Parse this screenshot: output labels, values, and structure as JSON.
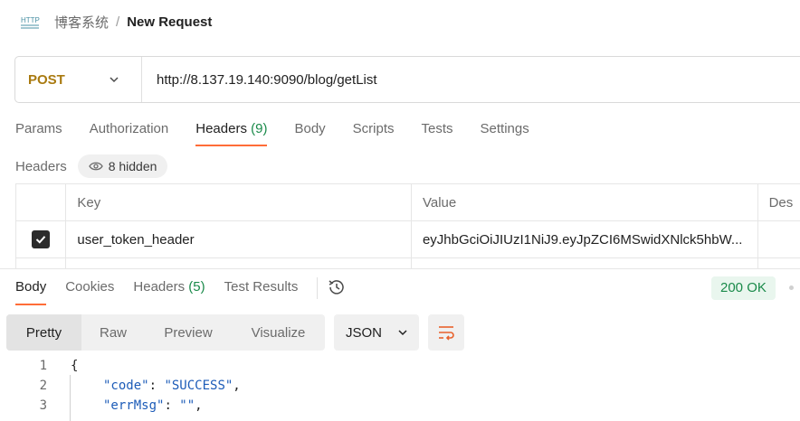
{
  "breadcrumb": {
    "parent": "博客系统",
    "separator": "/",
    "current": "New Request"
  },
  "request": {
    "method": "POST",
    "url": "http://8.137.19.140:9090/blog/getList"
  },
  "request_tabs": [
    {
      "label": "Params"
    },
    {
      "label": "Authorization"
    },
    {
      "label": "Headers",
      "count": "(9)",
      "active": true
    },
    {
      "label": "Body"
    },
    {
      "label": "Scripts"
    },
    {
      "label": "Tests"
    },
    {
      "label": "Settings"
    }
  ],
  "headers_section": {
    "title": "Headers",
    "hidden_label": "8 hidden"
  },
  "headers_table": {
    "columns": [
      "Key",
      "Value",
      "Des"
    ],
    "rows": [
      {
        "checked": true,
        "key": "user_token_header",
        "value": "eyJhbGciOiJIUzI1NiJ9.eyJpZCI6MSwidXNlck5hbW..."
      }
    ]
  },
  "response_tabs": [
    {
      "label": "Body",
      "active": true
    },
    {
      "label": "Cookies"
    },
    {
      "label": "Headers",
      "count": "(5)"
    },
    {
      "label": "Test Results"
    }
  ],
  "status": "200 OK",
  "format_buttons": [
    "Pretty",
    "Raw",
    "Preview",
    "Visualize"
  ],
  "format_select": "JSON",
  "code": {
    "line_numbers": [
      "1",
      "2",
      "3"
    ],
    "line1": "{",
    "line2_key": "\"code\"",
    "line2_colon": ": ",
    "line2_value": "\"SUCCESS\"",
    "line2_comma": ",",
    "line3_key": "\"errMsg\"",
    "line3_colon": ": ",
    "line3_value": "\"\"",
    "line3_comma": ","
  },
  "colors": {
    "accent": "#ff6c37",
    "method": "#a97a10",
    "success": "#1a8a4a",
    "json_string": "#1d5cb8"
  }
}
